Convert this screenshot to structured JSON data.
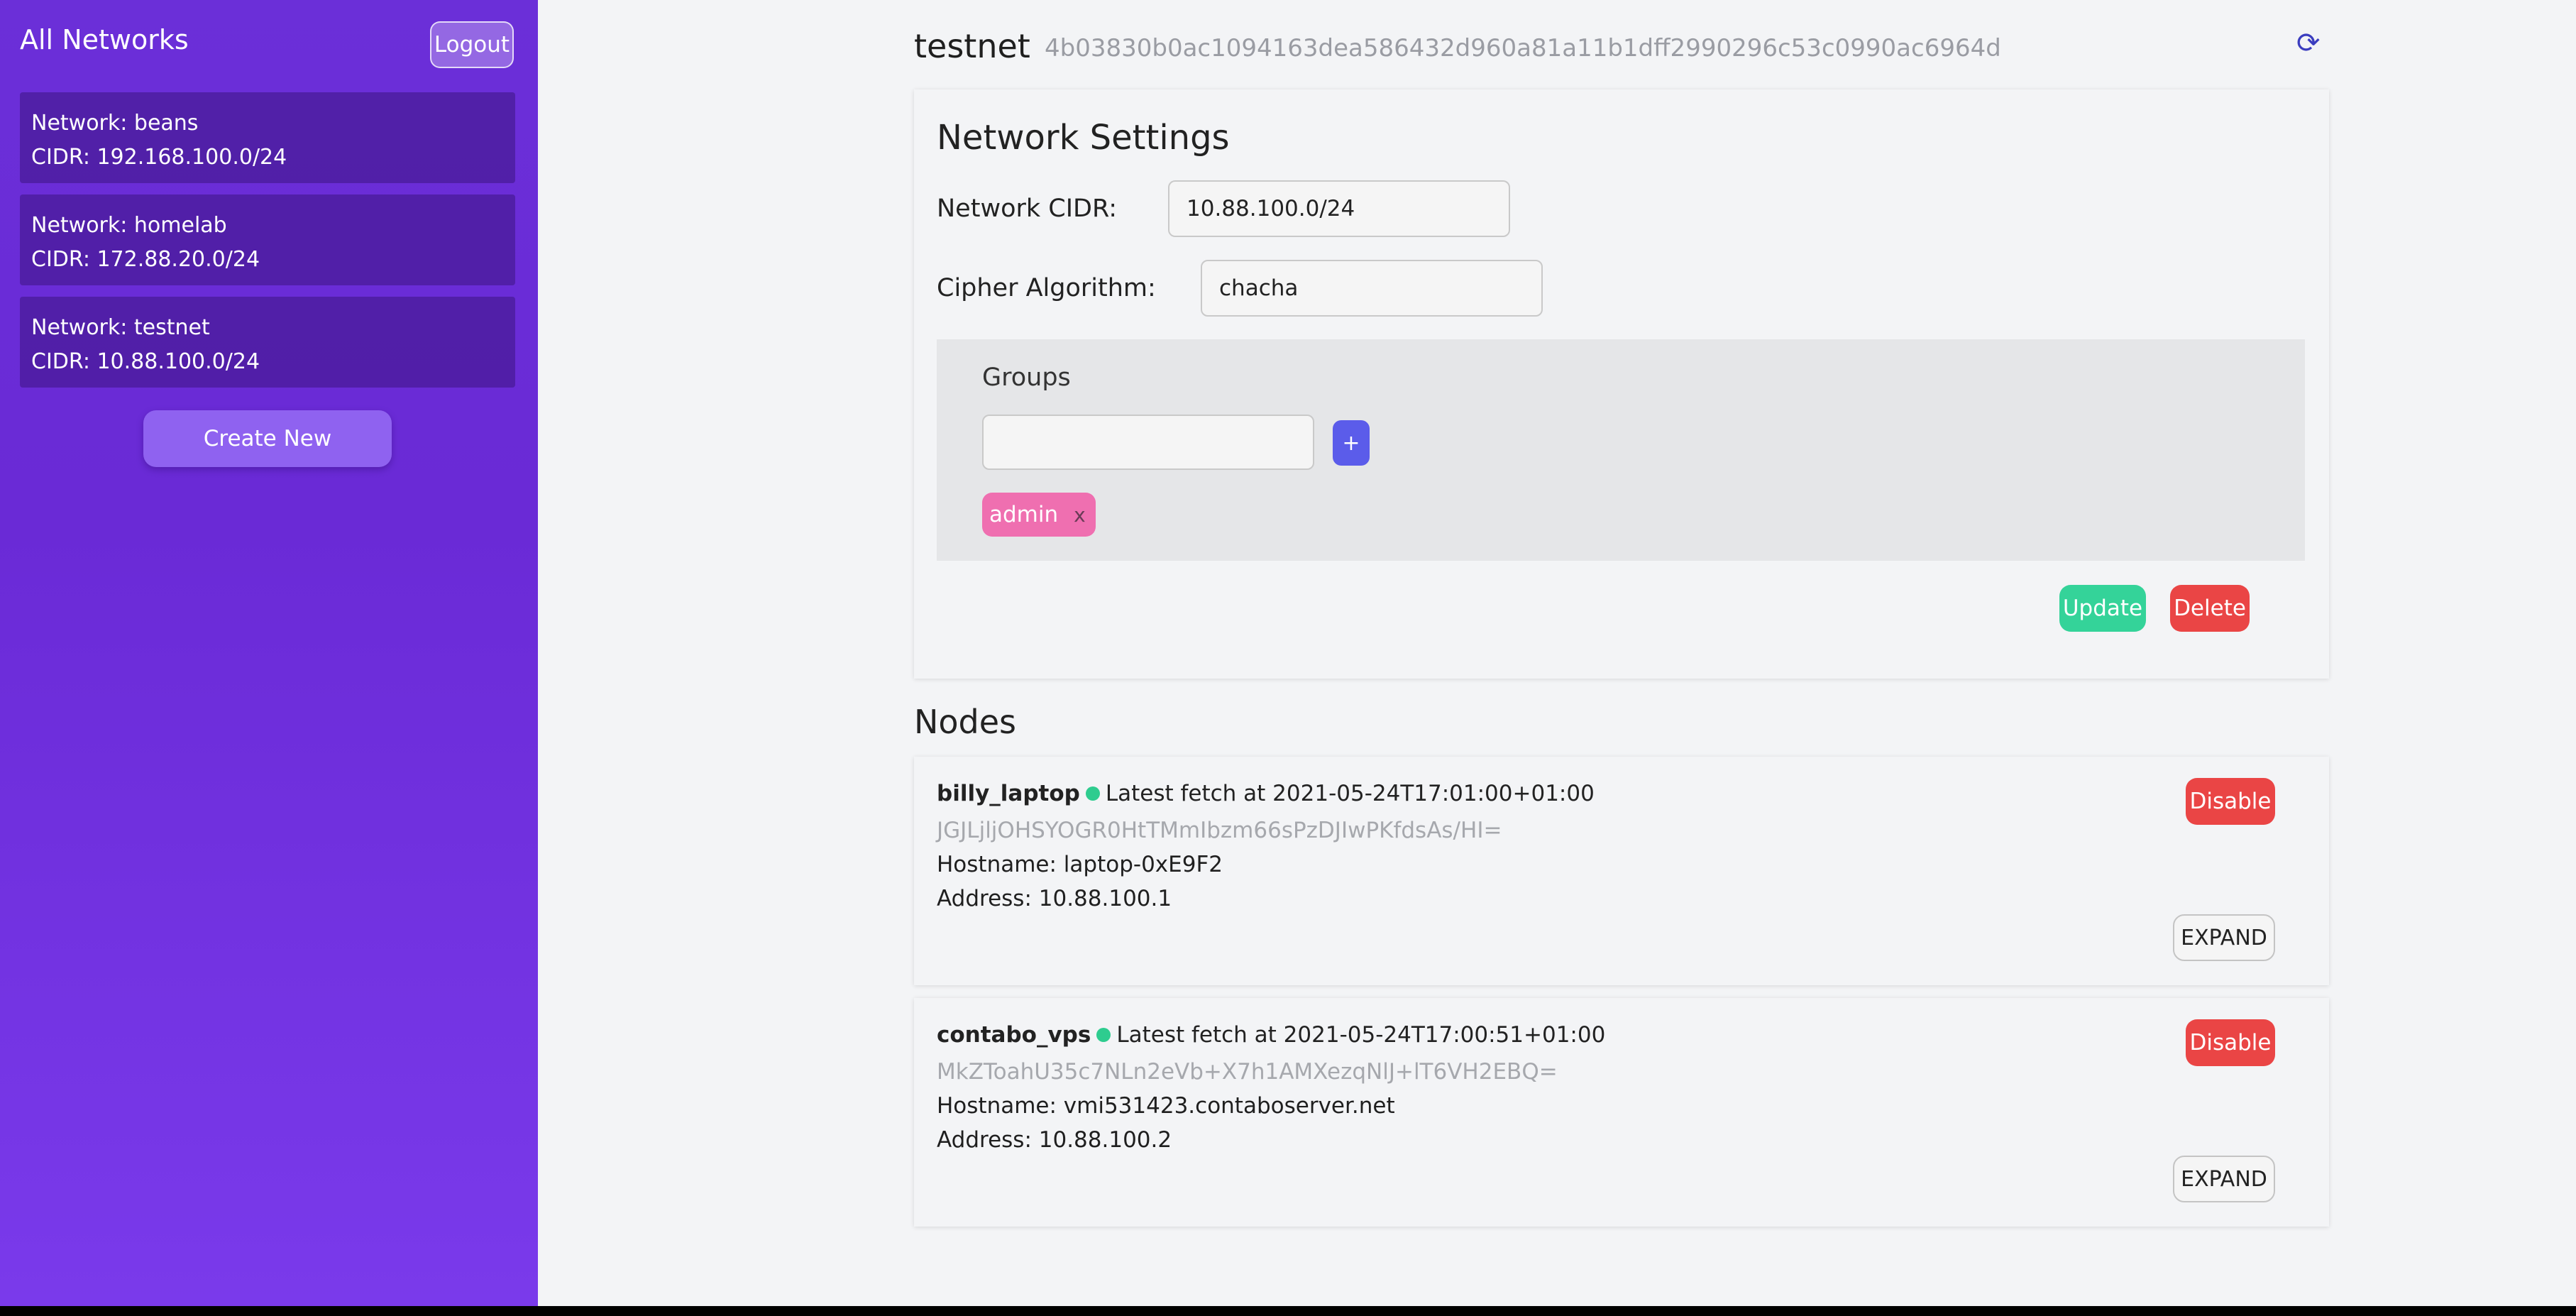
{
  "sidebar": {
    "title": "All Networks",
    "logout_label": "Logout",
    "networks": [
      {
        "name_line": "Network: beans",
        "cidr_line": "CIDR: 192.168.100.0/24"
      },
      {
        "name_line": "Network: homelab",
        "cidr_line": "CIDR: 172.88.20.0/24"
      },
      {
        "name_line": "Network: testnet",
        "cidr_line": "CIDR: 10.88.100.0/24"
      }
    ],
    "create_label": "Create New"
  },
  "header": {
    "network_name": "testnet",
    "network_id": "4b03830b0ac1094163dea586432d960a81a11b1dff2990296c53c0990ac6964d",
    "refresh_icon": "refresh-icon"
  },
  "settings": {
    "title": "Network Settings",
    "cidr_label": "Network CIDR:",
    "cidr_value": "10.88.100.0/24",
    "cipher_label": "Cipher Algorithm:",
    "cipher_value": "chacha",
    "groups": {
      "label": "Groups",
      "input_value": "",
      "add_label": "+",
      "tags": [
        {
          "label": "admin",
          "remove": "x"
        }
      ]
    },
    "update_label": "Update",
    "delete_label": "Delete"
  },
  "nodes": {
    "title": "Nodes",
    "items": [
      {
        "name": "billy_laptop",
        "fetch": "Latest fetch at 2021-05-24T17:01:00+01:00",
        "key": "JGJLjljOHSYOGR0HtTMmIbzm66sPzDJIwPKfdsAs/HI=",
        "hostname": "Hostname: laptop-0xE9F2",
        "address": "Address: 10.88.100.1",
        "disable_label": "Disable",
        "expand_label": "EXPAND"
      },
      {
        "name": "contabo_vps",
        "fetch": "Latest fetch at 2021-05-24T17:00:51+01:00",
        "key": "MkZToahU35c7NLn2eVb+X7h1AMXezqNlJ+lT6VH2EBQ=",
        "hostname": "Hostname: vmi531423.contaboserver.net",
        "address": "Address: 10.88.100.2",
        "disable_label": "Disable",
        "expand_label": "EXPAND"
      }
    ]
  },
  "colors": {
    "sidebar": "#6b2fd8",
    "update": "#34d399",
    "delete": "#ea4545",
    "tag": "#ef6fb0",
    "online": "#2ecc8f"
  }
}
